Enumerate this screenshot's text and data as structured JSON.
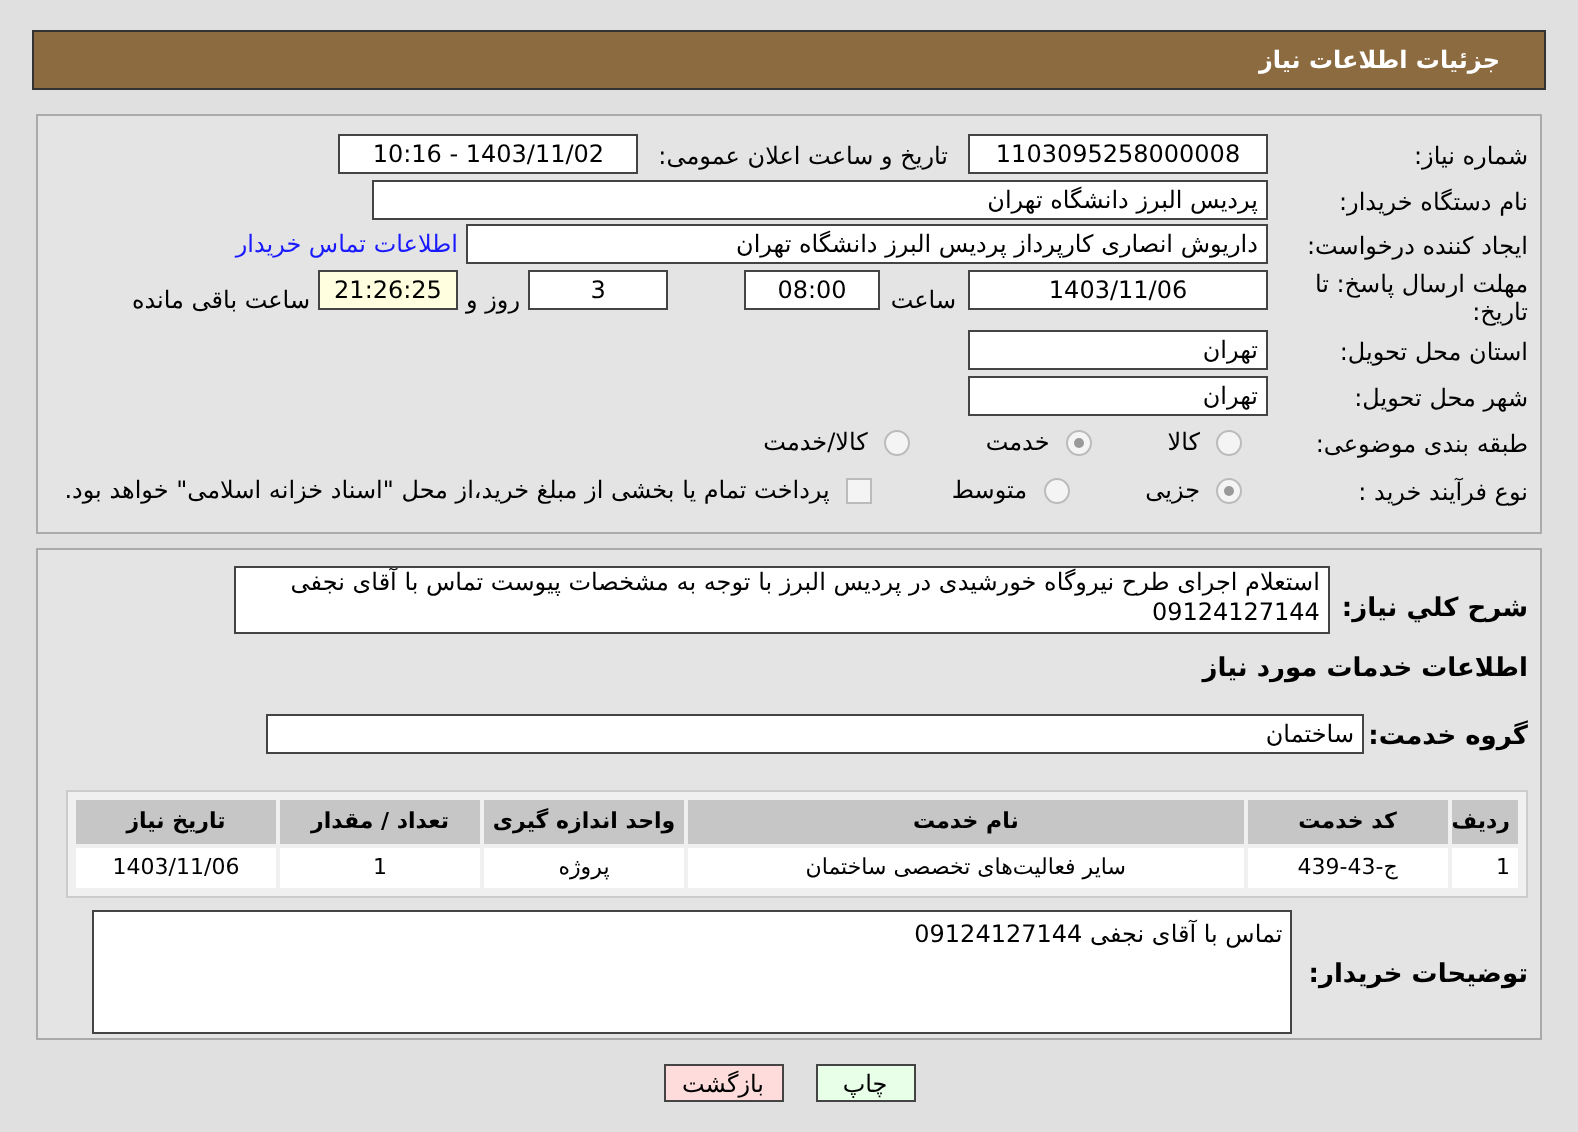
{
  "header": {
    "title": "جزئیات اطلاعات نیاز"
  },
  "need": {
    "number_label": "شماره نیاز:",
    "number": "1103095258000008",
    "announce_label": "تاریخ و ساعت اعلان عمومی:",
    "announce": "1403/11/02 - 10:16",
    "buyer_label": "نام دستگاه خریدار:",
    "buyer": "پردیس البرز دانشگاه تهران",
    "creator_label": "ایجاد کننده درخواست:",
    "creator": "داریوش انصاری کارپرداز پردیس البرز دانشگاه تهران",
    "contact_link": "اطلاعات تماس خریدار",
    "deadline_label": "مهلت ارسال پاسخ: تا تاریخ:",
    "deadline_date": "1403/11/06",
    "time_label": "ساعت",
    "deadline_time": "08:00",
    "days": "3",
    "days_label": "روز و",
    "remaining": "21:26:25",
    "remaining_label": "ساعت باقی مانده",
    "province_label": "استان محل تحویل:",
    "province": "تهران",
    "city_label": "شهر محل تحویل:",
    "city": "تهران",
    "category_label": "طبقه بندی موضوعی:",
    "categories": [
      {
        "label": "کالا",
        "selected": false
      },
      {
        "label": "خدمت",
        "selected": true
      },
      {
        "label": "کالا/خدمت",
        "selected": false
      }
    ],
    "process_label": "نوع فرآیند خرید :",
    "processes": [
      {
        "label": "جزیی",
        "selected": true
      },
      {
        "label": "متوسط",
        "selected": false
      }
    ],
    "treasury": {
      "checked": false,
      "label": "پرداخت تمام یا بخشی از مبلغ خرید،از محل \"اسناد خزانه اسلامی\" خواهد بود."
    }
  },
  "details": {
    "description_label": "شرح کلي نياز:",
    "description": "استعلام اجرای طرح نیروگاه خورشیدی در پردیس البرز با توجه به مشخصات پیوست تماس با آقای نجفی 09124127144",
    "services_heading": "اطلاعات خدمات مورد نیاز",
    "group_label": "گروه خدمت:",
    "group": "ساختمان",
    "table": {
      "columns": [
        "ردیف",
        "کد خدمت",
        "نام خدمت",
        "واحد اندازه گیری",
        "تعداد / مقدار",
        "تاریخ نیاز"
      ],
      "rows": [
        [
          "1",
          "ج-43-439",
          "سایر فعالیت‌های تخصصی ساختمان",
          "پروژه",
          "1",
          "1403/11/06"
        ]
      ]
    },
    "notes_label": "توضیحات خریدار:",
    "notes": "تماس با آقای نجفی 09124127144"
  },
  "buttons": {
    "print": "چاپ",
    "back": "بازگشت"
  }
}
